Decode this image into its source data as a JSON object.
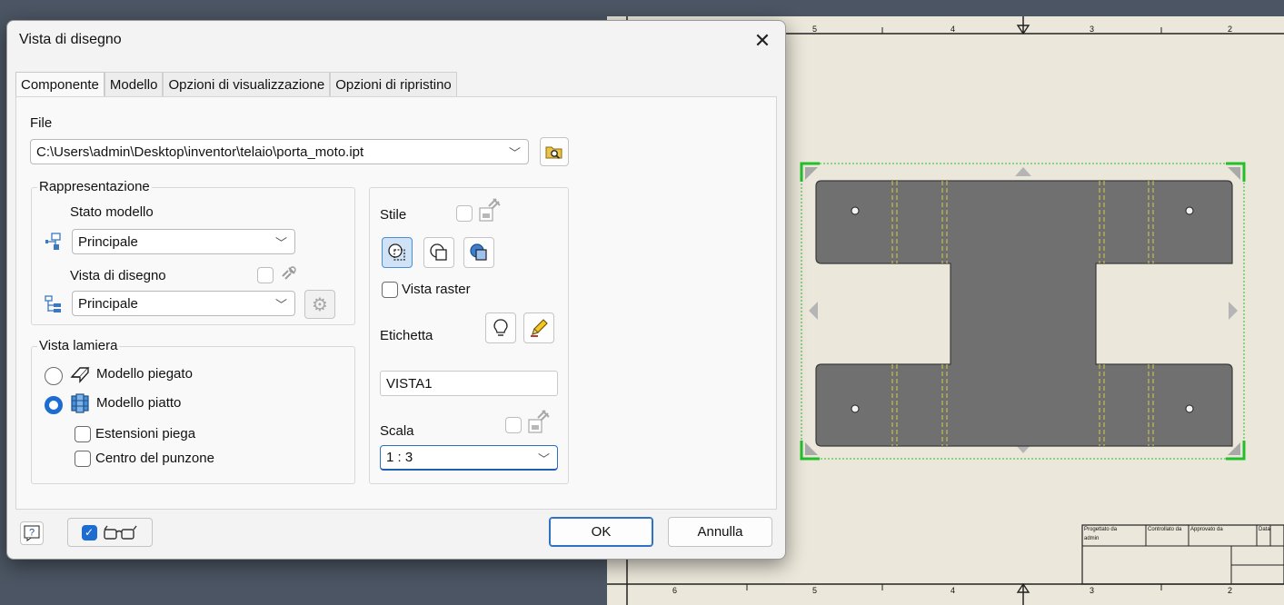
{
  "dialog": {
    "title": "Vista di disegno",
    "close_icon": "close-icon"
  },
  "tabs": [
    {
      "label": "Componente",
      "active": true
    },
    {
      "label": "Modello",
      "active": false
    },
    {
      "label": "Opzioni di visualizzazione",
      "active": false
    },
    {
      "label": "Opzioni di ripristino",
      "active": false
    }
  ],
  "file": {
    "label": "File",
    "path": "C:\\Users\\admin\\Desktop\\inventor\\telaio\\porta_moto.ipt",
    "browse_icon": "folder-search-icon"
  },
  "representation": {
    "group_label": "Rappresentazione",
    "model_state_label": "Stato modello",
    "model_state_value": "Principale",
    "drawing_view_label": "Vista di disegno",
    "drawing_view_value": "Principale"
  },
  "sheet_metal": {
    "group_label": "Vista lamiera",
    "folded_label": "Modello piegato",
    "flat_label": "Modello piatto",
    "selected": "flat",
    "bend_extents_label": "Estensioni piega",
    "punch_center_label": "Centro del punzone"
  },
  "style": {
    "label": "Stile",
    "selected_index": 0,
    "raster_label": "Vista raster"
  },
  "label_section": {
    "label": "Etichetta",
    "value": "VISTA1"
  },
  "scale": {
    "label": "Scala",
    "value": "1 : 3"
  },
  "footer": {
    "ok_label": "OK",
    "cancel_label": "Annulla",
    "preview_checked": true
  },
  "sheet": {
    "ruler_top": [
      "5",
      "4",
      "3",
      "2"
    ],
    "ruler_bottom": [
      "6",
      "5",
      "4",
      "3",
      "2"
    ],
    "title_block": {
      "designed_by_label": "Progettato da",
      "designed_by_value": "admin",
      "checked_by_label": "Controllato da",
      "approved_by_label": "Approvato da",
      "date_label": "Data"
    }
  },
  "colors": {
    "accent": "#1d6cd1",
    "sheet_bg": "#ebe7da",
    "part_fill": "#6f6f6f",
    "selection_green": "#22c02a"
  }
}
